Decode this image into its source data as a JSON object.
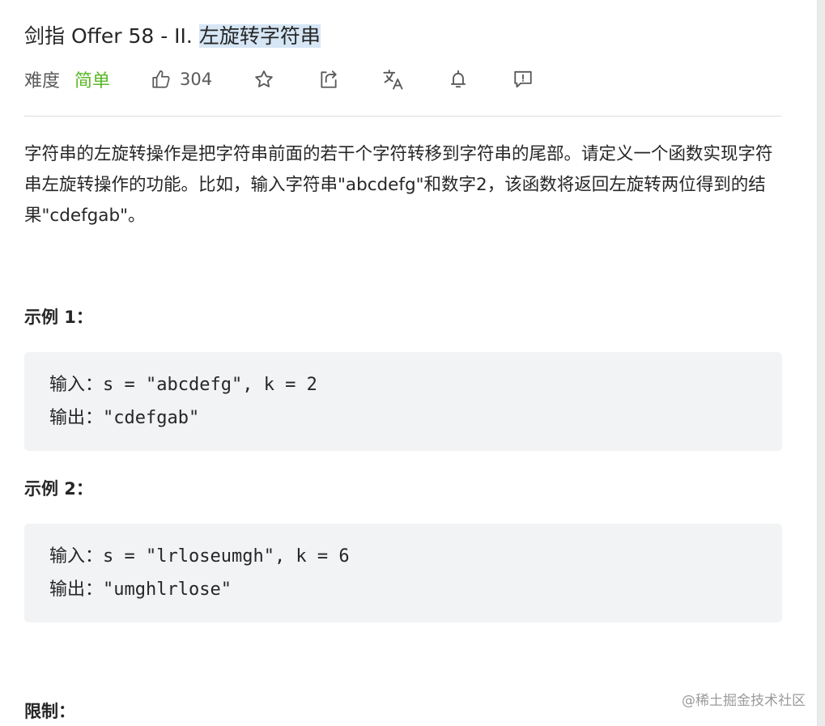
{
  "problem": {
    "title_prefix": "剑指 Offer 58 - II. ",
    "title_highlight": "左旋转字符串",
    "difficulty_label": "难度",
    "difficulty_value": "简单",
    "like_count": "304",
    "description": "字符串的左旋转操作是把字符串前面的若干个字符转移到字符串的尾部。请定义一个函数实现字符串左旋转操作的功能。比如，输入字符串\"abcdefg\"和数字2，该函数将返回左旋转两位得到的结果\"cdefgab\"。"
  },
  "examples": [
    {
      "heading": "示例 1：",
      "input_label": "输入：",
      "input_value": "s = \"abcdefg\", k = 2",
      "output_label": "输出：",
      "output_value": "\"cdefgab\""
    },
    {
      "heading": "示例 2：",
      "input_label": "输入：",
      "input_value": "s = \"lrloseumgh\", k = 6",
      "output_label": "输出：",
      "output_value": "\"umghlrlose\""
    }
  ],
  "constraints_heading": "限制：",
  "watermark": "@稀土掘金技术社区",
  "colors": {
    "difficulty_easy": "#5ab726",
    "title_highlight_bg": "#d6e6f5",
    "code_bg": "#f2f3f5"
  },
  "icons": [
    "thumbs-up-icon",
    "star-icon",
    "share-icon",
    "translate-icon",
    "bell-icon",
    "feedback-icon"
  ]
}
